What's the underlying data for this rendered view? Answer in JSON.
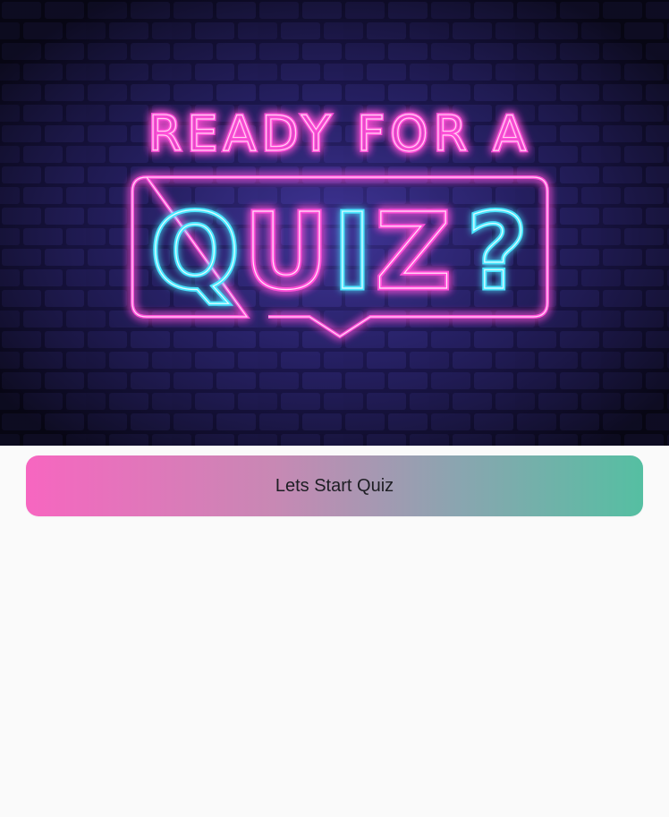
{
  "hero": {
    "line1": "READY FOR A",
    "line2_letters": [
      "Q",
      "U",
      "I",
      "Z",
      "?"
    ],
    "colors": {
      "pink_neon": "#ff4fd8",
      "cyan_neon": "#49e6ff",
      "wall": "#1a1840",
      "wall_glow": "#3a2f8f"
    }
  },
  "start_button": {
    "label": "Lets Start Quiz",
    "gradient_start": "#f766c0",
    "gradient_end": "#55bfa2"
  }
}
